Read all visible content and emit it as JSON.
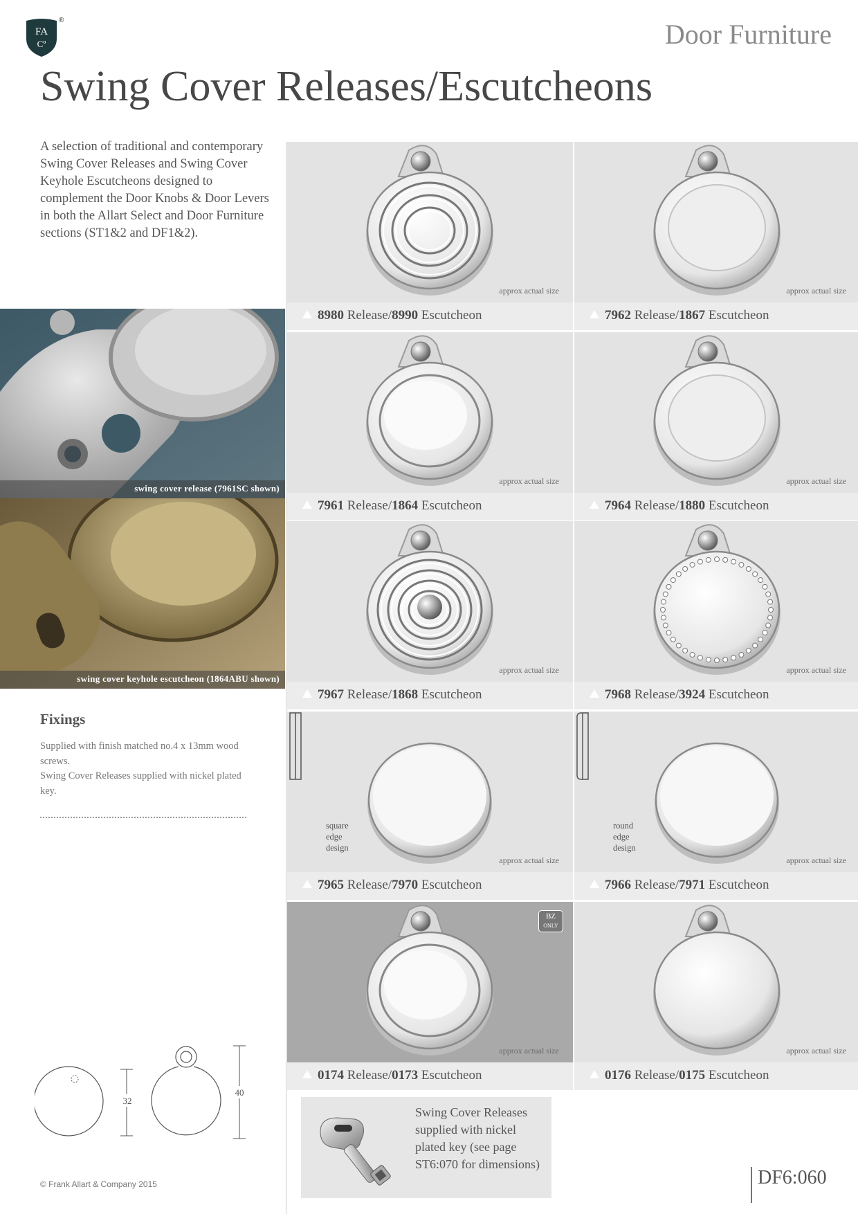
{
  "header": {
    "logo_text_top": "FA",
    "logo_text_bottom": "Cº",
    "registered": "®",
    "section": "Door Furniture",
    "title": "Swing Cover Releases/Escutcheons"
  },
  "intro": "A selection of traditional and contemporary Swing Cover Releases and Swing Cover Keyhole Escutcheons designed to complement the Door Knobs & Door Levers in both the Allart Select and Door Furniture sections (ST1&2 and DF1&2).",
  "photos": [
    {
      "caption": "swing cover release (7961SC shown)"
    },
    {
      "caption": "swing cover keyhole escutcheon (1864ABU shown)"
    }
  ],
  "fixings": {
    "title": "Fixings",
    "line1": "Supplied with finish matched no.4 x 13mm wood screws.",
    "line2": "Swing Cover Releases supplied with nickel plated key."
  },
  "approx_label": "approx actual size",
  "products": [
    {
      "release": "8980",
      "release_word": "Release/",
      "escutcheon": "8990",
      "escutcheon_word": "Escutcheon"
    },
    {
      "release": "7962",
      "release_word": "Release/",
      "escutcheon": "1867",
      "escutcheon_word": "Escutcheon"
    },
    {
      "release": "7961",
      "release_word": "Release/",
      "escutcheon": "1864",
      "escutcheon_word": "Escutcheon"
    },
    {
      "release": "7964",
      "release_word": "Release/",
      "escutcheon": "1880",
      "escutcheon_word": "Escutcheon"
    },
    {
      "release": "7967",
      "release_word": "Release/",
      "escutcheon": "1868",
      "escutcheon_word": "Escutcheon"
    },
    {
      "release": "7968",
      "release_word": "Release/",
      "escutcheon": "3924",
      "escutcheon_word": "Escutcheon"
    },
    {
      "release": "7965",
      "release_word": "Release/",
      "escutcheon": "7970",
      "escutcheon_word": "Escutcheon",
      "edge": "square edge design"
    },
    {
      "release": "7966",
      "release_word": "Release/",
      "escutcheon": "7971",
      "escutcheon_word": "Escutcheon",
      "edge": "round edge design"
    },
    {
      "release": "0174",
      "release_word": "Release/",
      "escutcheon": "0173",
      "escutcheon_word": "Escutcheon",
      "badge_top": "BZ",
      "badge_bottom": "ONLY"
    },
    {
      "release": "0176",
      "release_word": "Release/",
      "escutcheon": "0175",
      "escutcheon_word": "Escutcheon"
    }
  ],
  "edge_labels": {
    "square": [
      "square",
      "edge",
      "design"
    ],
    "round": [
      "round",
      "edge",
      "design"
    ]
  },
  "dimensions": {
    "small": "32",
    "large": "40"
  },
  "key_note": "Swing Cover Releases supplied with nickel plated key (see page ST6:070 for dimensions)",
  "footer": {
    "copyright": "© Frank Allart & Company 2015",
    "page_code": "DF6:060"
  }
}
